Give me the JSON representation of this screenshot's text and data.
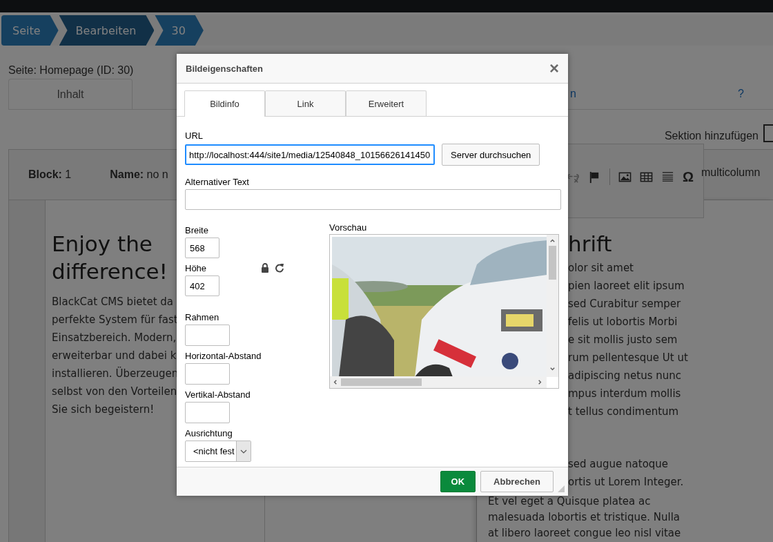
{
  "breadcrumbs": [
    {
      "label": "Seite",
      "selected": false
    },
    {
      "label": "Bearbeiten",
      "selected": true
    },
    {
      "label": "30",
      "selected": false
    }
  ],
  "page_title": "Seite: Homepage (ID: 30)",
  "page_tabs": [
    {
      "label": "Inhalt",
      "selected": true
    },
    {
      "label": "n",
      "selected": false
    }
  ],
  "help_link": "?",
  "add_section": "Sektion hinzufügen",
  "block": {
    "number": "**Block:** 1",
    "name": "**Name:** no n"
  },
  "toolbar": {
    "special_char": "Ω",
    "format": "multicolumn"
  },
  "left_column": {
    "heading": "Enjoy the\ndifference!",
    "text": "BlackCat CMS bietet da\nperfekte System für fast\nEinsatzbereich. Modern,\nerweiterbar und dabei k\ninstallieren. Überzeugen\nselbst von den Vorteilen\nSie sich begeistern!"
  },
  "right_column": {
    "heading": "hrift",
    "cut_text": "olor sit amet\npien laoreet elit ipsum\nsed Curabitur semper\nfelis ut lobortis Morbi\ne sit mollis justo sem\nrum pellentesque Ut ut\nadipiscing netus nunc\nmpus interdum mollis\nt tellus condimentum",
    "cut_text_2": "sed augue natoque\nortis ut Lorem Integer.",
    "text": "Et vel eget a Quisque platea ac\nmalesuada lobortis et tristique. Nulla\nat libero laoreet congue leo nisl vitae"
  },
  "dialog": {
    "title": "Bildeigenschaften",
    "close": "×",
    "tabs": [
      {
        "label": "Bildinfo",
        "selected": true
      },
      {
        "label": "Link",
        "selected": false
      },
      {
        "label": "Erweitert",
        "selected": false
      }
    ],
    "url": {
      "label": "URL",
      "value": "http://localhost:444/site1/media/12540848_10156626141450"
    },
    "browse_button": "Server durchsuchen",
    "alt_text": {
      "label": "Alternativer Text"
    },
    "width": {
      "label": "Breite",
      "value": "568"
    },
    "height": {
      "label": "Höhe",
      "value": "402"
    },
    "border": {
      "label": "Rahmen"
    },
    "hspace": {
      "label": "Horizontal-Abstand"
    },
    "vspace": {
      "label": "Vertikal-Abstand"
    },
    "align": {
      "label": "Ausrichtung",
      "value": "<nicht fest"
    },
    "preview": {
      "label": "Vorschau"
    },
    "buttons": [
      {
        "label": "OK",
        "kind": "primary"
      },
      {
        "label": "Abbrechen",
        "kind": "secondary"
      }
    ]
  }
}
